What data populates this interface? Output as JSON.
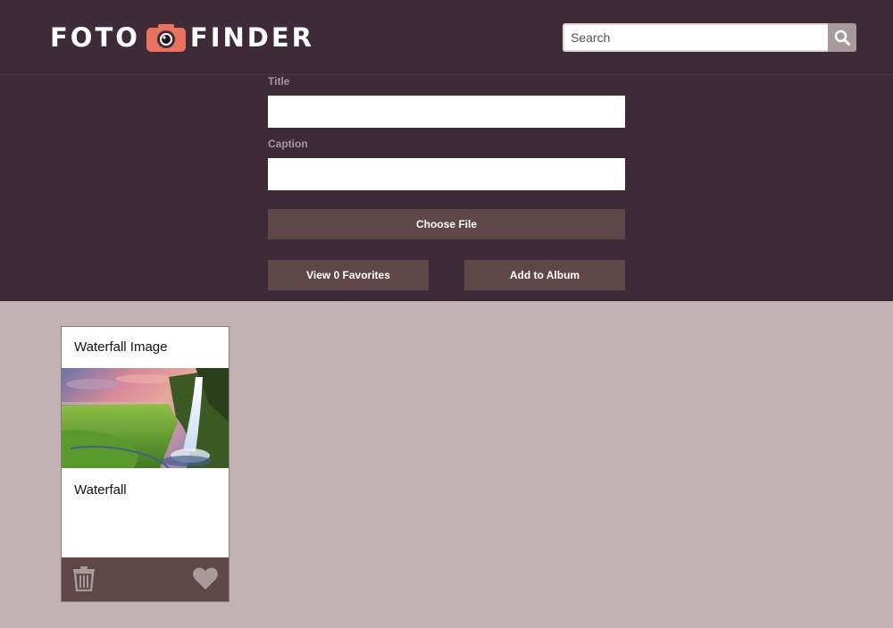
{
  "header": {
    "logo": {
      "left": "FOTO",
      "right": "FINDER",
      "icon": "camera-icon"
    },
    "search": {
      "placeholder": "Search",
      "icon": "search-icon"
    }
  },
  "form": {
    "title_label": "Title",
    "title_value": "",
    "caption_label": "Caption",
    "caption_value": "",
    "choose_file_label": "Choose File",
    "view_favorites_label": "View 0 Favorites",
    "add_to_album_label": "Add to Album"
  },
  "cards": [
    {
      "title": "Waterfall Image",
      "caption": "Waterfall",
      "image": "waterfall-photo",
      "delete_icon": "trash-icon",
      "favorite_icon": "heart-icon"
    }
  ],
  "colors": {
    "header_bg": "#3f2a38",
    "page_bg": "#c3b2b5",
    "button_bg": "#5e4649",
    "camera_accent": "#e8735f"
  }
}
